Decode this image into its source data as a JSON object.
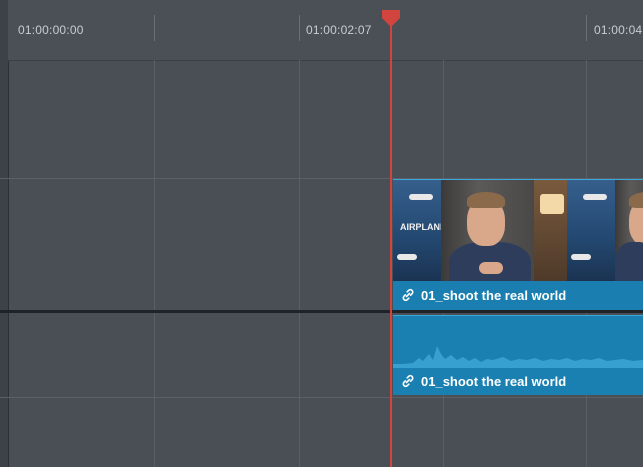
{
  "ruler": {
    "timecodes": [
      {
        "label": "01:00:00:00"
      },
      {
        "label": "01:00:02:07"
      },
      {
        "label": "01:00:04"
      }
    ]
  },
  "clips": {
    "video": {
      "name": "01_shoot the real world",
      "color": "#1a7fb0",
      "poster_text": "AIRPLANES"
    },
    "audio": {
      "name": "01_shoot the real world",
      "color": "#1a80b2"
    }
  },
  "playhead": {
    "color": "#d2453f"
  },
  "icons": {
    "link": "link-icon"
  }
}
